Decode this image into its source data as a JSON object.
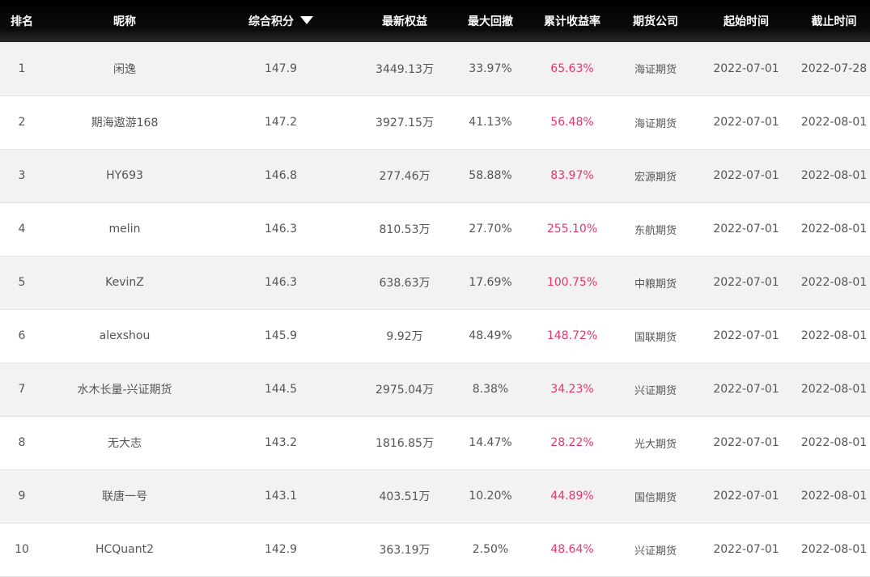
{
  "table": {
    "headers": {
      "rank": "排名",
      "nickname": "昵称",
      "score": "综合积分",
      "equity": "最新权益",
      "drawdown": "最大回撤",
      "return": "累计收益率",
      "company": "期货公司",
      "start": "起始时间",
      "end": "截止时间"
    },
    "sort": {
      "column": "score",
      "direction": "descending",
      "icon": "caret-down-icon"
    },
    "row_colors": {
      "odd": "#f2f2f2",
      "even": "#ffffff",
      "return_text": "#e8336e",
      "header_bg": "#000000"
    },
    "rows": [
      {
        "rank": "1",
        "nickname": "闲逸",
        "score": "147.9",
        "equity": "3449.13万",
        "drawdown": "33.97%",
        "return": "65.63%",
        "company": "海证期货",
        "start": "2022-07-01",
        "end": "2022-07-28"
      },
      {
        "rank": "2",
        "nickname": "期海遨游168",
        "score": "147.2",
        "equity": "3927.15万",
        "drawdown": "41.13%",
        "return": "56.48%",
        "company": "海证期货",
        "start": "2022-07-01",
        "end": "2022-08-01"
      },
      {
        "rank": "3",
        "nickname": "HY693",
        "score": "146.8",
        "equity": "277.46万",
        "drawdown": "58.88%",
        "return": "83.97%",
        "company": "宏源期货",
        "start": "2022-07-01",
        "end": "2022-08-01"
      },
      {
        "rank": "4",
        "nickname": "melin",
        "score": "146.3",
        "equity": "810.53万",
        "drawdown": "27.70%",
        "return": "255.10%",
        "company": "东航期货",
        "start": "2022-07-01",
        "end": "2022-08-01"
      },
      {
        "rank": "5",
        "nickname": "KevinZ",
        "score": "146.3",
        "equity": "638.63万",
        "drawdown": "17.69%",
        "return": "100.75%",
        "company": "中粮期货",
        "start": "2022-07-01",
        "end": "2022-08-01"
      },
      {
        "rank": "6",
        "nickname": "alexshou",
        "score": "145.9",
        "equity": "9.92万",
        "drawdown": "48.49%",
        "return": "148.72%",
        "company": "国联期货",
        "start": "2022-07-01",
        "end": "2022-08-01"
      },
      {
        "rank": "7",
        "nickname": "水木长量-兴证期货",
        "score": "144.5",
        "equity": "2975.04万",
        "drawdown": "8.38%",
        "return": "34.23%",
        "company": "兴证期货",
        "start": "2022-07-01",
        "end": "2022-08-01"
      },
      {
        "rank": "8",
        "nickname": "无大志",
        "score": "143.2",
        "equity": "1816.85万",
        "drawdown": "14.47%",
        "return": "28.22%",
        "company": "光大期货",
        "start": "2022-07-01",
        "end": "2022-08-01"
      },
      {
        "rank": "9",
        "nickname": "联唐一号",
        "score": "143.1",
        "equity": "403.51万",
        "drawdown": "10.20%",
        "return": "44.89%",
        "company": "国信期货",
        "start": "2022-07-01",
        "end": "2022-08-01"
      },
      {
        "rank": "10",
        "nickname": "HCQuant2",
        "score": "142.9",
        "equity": "363.19万",
        "drawdown": "2.50%",
        "return": "48.64%",
        "company": "兴证期货",
        "start": "2022-07-01",
        "end": "2022-08-01"
      }
    ]
  }
}
